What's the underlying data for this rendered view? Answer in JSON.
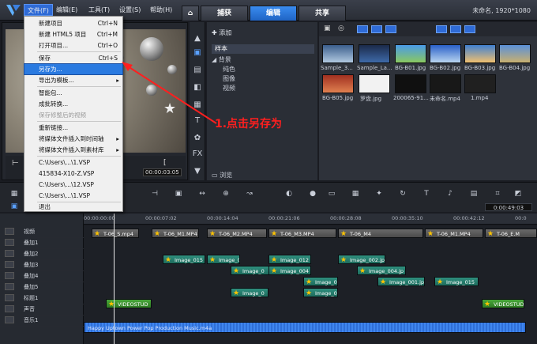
{
  "menubar": {
    "file": "文件(F)",
    "edit": "编辑(E)",
    "tools": "工具(T)",
    "settings": "设置(S)",
    "help": "帮助(H)"
  },
  "tabs": {
    "capture": "捕获",
    "edit": "编辑",
    "share": "共享"
  },
  "window_title": "未命名, 1920*1080",
  "file_menu": {
    "items": [
      {
        "label": "新建项目",
        "shortcut": "Ctrl+N"
      },
      {
        "label": "新建 HTML5 项目",
        "shortcut": "Ctrl+M"
      },
      {
        "label": "打开项目...",
        "shortcut": "Ctrl+O"
      },
      {
        "label": "保存",
        "shortcut": "Ctrl+S"
      },
      {
        "label": "另存为...",
        "shortcut": ""
      },
      {
        "label": "导出为模板...",
        "shortcut": ""
      },
      {
        "label": "智能包...",
        "shortcut": ""
      },
      {
        "label": "成批转换...",
        "shortcut": ""
      },
      {
        "label": "保存修整后的视频",
        "shortcut": ""
      },
      {
        "label": "重新链接...",
        "shortcut": ""
      },
      {
        "label": "将媒体文件插入到时间轴",
        "shortcut": ""
      },
      {
        "label": "将媒体文件插入到素材库",
        "shortcut": ""
      },
      {
        "label": "C:\\Users\\...\\1.VSP",
        "shortcut": ""
      },
      {
        "label": "415834-X10-Z.VSP",
        "shortcut": ""
      },
      {
        "label": "C:\\Users\\...\\12.VSP",
        "shortcut": ""
      },
      {
        "label": "C:\\Users\\...\\1.VSP",
        "shortcut": ""
      },
      {
        "label": "退出",
        "shortcut": ""
      }
    ]
  },
  "annotation": "1.点击另存为",
  "library": {
    "add": "添加",
    "tree": [
      "样本",
      "背景",
      "纯色",
      "图像",
      "视频"
    ],
    "browse": "浏览",
    "thumbs": [
      "Sample_3...",
      "Sample_La...",
      "BG-B01.jpg",
      "BG-B02.jpg",
      "BG-B03.jpg",
      "BG-B04.jpg",
      "BG-B05.jpg",
      "罗盘.jpg",
      "200065-91...",
      "未命名.mp4",
      "1.mp4"
    ]
  },
  "preview": {
    "timecode": "00:00:03:05"
  },
  "timeline": {
    "timecode": "0:00:49:03",
    "ruler": [
      "00:00:00:00",
      "00:00:07:02",
      "00:00:14:04",
      "00:00:21:06",
      "00:00:28:08",
      "00:00:35:10",
      "00:00:42:12",
      "00:0"
    ],
    "tracks": [
      "视频",
      "叠加1",
      "叠加2",
      "叠加3",
      "叠加4",
      "叠加5",
      "标题1",
      "声音",
      "音乐1"
    ],
    "video_clips": [
      "T-06_S.mp4",
      "T-06_M1.MP4",
      "T-06_M2.MP4",
      "T-06_M3.MP4",
      "T-06_M4",
      "T-06_M1.MP4",
      "T-06_E.M"
    ],
    "overlay_clips": [
      "Image_015",
      "Image_0",
      "Image_012",
      "Image_002.jp",
      "Image_0",
      "Image_004",
      "Image_004.jp",
      "Image_0",
      "Image_001.jp",
      "Image_015",
      "Image_0",
      "Image_0"
    ],
    "title_clips": [
      "VIDEOSTUD",
      "VIDEOSTUD"
    ],
    "music": "Happy Uptown Power Pop Production Music.m4a"
  },
  "colors": {
    "accent": "#2f6bd6",
    "annotation": "#ff1f1f"
  }
}
